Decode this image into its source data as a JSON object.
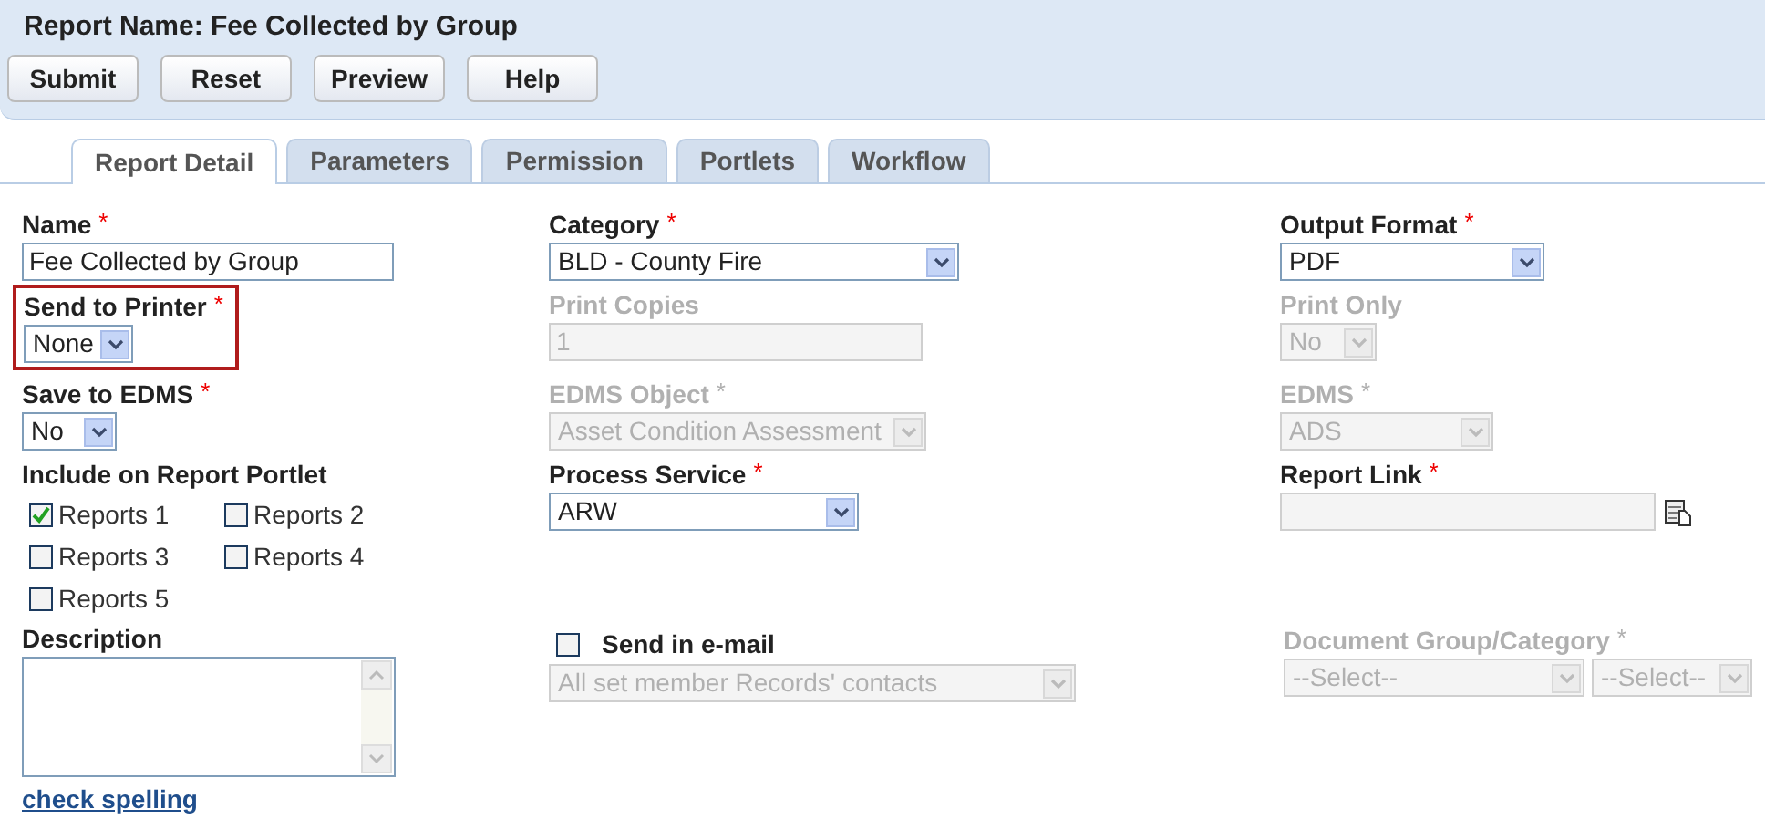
{
  "report_name": "Report Name: Fee Collected by Group",
  "buttons": [
    "Submit",
    "Reset",
    "Preview",
    "Help"
  ],
  "tabs": [
    {
      "label": "Report Detail",
      "selected": true
    },
    {
      "label": "Parameters",
      "selected": false
    },
    {
      "label": "Permission",
      "selected": false
    },
    {
      "label": "Portlets",
      "selected": false
    },
    {
      "label": "Workflow",
      "selected": false
    }
  ],
  "rows": [
    [
      {
        "kind": "text",
        "label": "Name",
        "required_mark": "*",
        "disabled": false,
        "value": "Fee Collected by Group"
      },
      {
        "kind": "select",
        "label": "Category",
        "required_mark": "*",
        "disabled": false,
        "value": "BLD - County Fire"
      },
      {
        "kind": "select",
        "label": "Output Format",
        "required_mark": "*",
        "disabled": false,
        "value": "PDF"
      }
    ],
    [
      {
        "kind": "select",
        "label": "Send to Printer",
        "required_mark": "*",
        "disabled": false,
        "highlighted": true,
        "value": "None"
      },
      {
        "kind": "text",
        "label": "Print Copies",
        "disabled": true,
        "value": "1"
      },
      {
        "kind": "select",
        "label": "Print Only",
        "disabled": true,
        "value": "No"
      }
    ],
    [
      {
        "kind": "select",
        "label": "Save to EDMS",
        "required_mark": "*",
        "disabled": false,
        "value": "No"
      },
      {
        "kind": "select",
        "label": "EDMS Object",
        "required_mark": "*",
        "disabled": true,
        "value": "Asset Condition Assessment"
      },
      {
        "kind": "select",
        "label": "EDMS",
        "required_mark": "*",
        "disabled": true,
        "value": "ADS"
      }
    ],
    [
      {
        "kind": "checkboxes",
        "label": "Include on Report Portlet",
        "options": [
          {
            "label": "Reports 1",
            "checked": true
          },
          {
            "label": "Reports 2",
            "checked": false
          },
          {
            "label": "Reports 3",
            "checked": false
          },
          {
            "label": "Reports 4",
            "checked": false
          },
          {
            "label": "Reports 5",
            "checked": false
          }
        ]
      },
      {
        "kind": "select",
        "label": "Process Service",
        "required_mark": "*",
        "disabled": false,
        "value": "ARW"
      },
      {
        "kind": "lookup",
        "label": "Report Link",
        "required_mark": "*"
      }
    ],
    [
      {
        "kind": "textarea",
        "label": "Description",
        "link": "check spelling"
      },
      {
        "kind": "email",
        "label": "Send in e-mail",
        "checked": false,
        "disabled": true,
        "value": "All set member Records' contacts"
      },
      {
        "kind": "double_select",
        "label": "Document Group/Category",
        "required_mark": "*",
        "disabled": true,
        "values": [
          "--Select--",
          "--Select--"
        ]
      }
    ]
  ]
}
